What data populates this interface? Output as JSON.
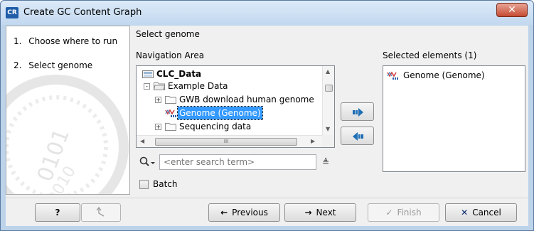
{
  "window": {
    "title": "Create GC Content Graph",
    "icon_text": "CR",
    "close_glyph": "✕"
  },
  "steps": {
    "items": [
      {
        "number": "1.",
        "label": "Choose where to run"
      },
      {
        "number": "2.",
        "label": "Select genome"
      }
    ],
    "current_index": 1
  },
  "main": {
    "section_title": "Select genome",
    "navigation_label": "Navigation Area",
    "selected_label": "Selected elements (1)"
  },
  "tree": {
    "root": "CLC_Data",
    "items": [
      {
        "label": "Example Data",
        "expander": "-",
        "icon": "folder-open-icon"
      },
      {
        "label": "GWB download human genome",
        "expander": "+",
        "icon": "folder-icon"
      },
      {
        "label": "Genome (Genome)",
        "expander": "",
        "icon": "genome-track-icon",
        "selected": true
      },
      {
        "label": "Sequencing data",
        "expander": "+",
        "icon": "folder-icon"
      }
    ],
    "hscroll_thumb_glyph": "III"
  },
  "search": {
    "placeholder": "<enter search term>",
    "options_glyph": "≜"
  },
  "batch": {
    "label": "Batch",
    "checked": false
  },
  "selected_elements": [
    {
      "label": "Genome (Genome)",
      "icon": "genome-track-icon"
    }
  ],
  "buttons": {
    "help": "?",
    "previous": "Previous",
    "next": "Next",
    "finish": "Finish",
    "cancel": "Cancel"
  },
  "colors": {
    "selection": "#3399ff",
    "move_arrow": "#1f6fb5",
    "cancel_x": "#0a2a6e"
  }
}
